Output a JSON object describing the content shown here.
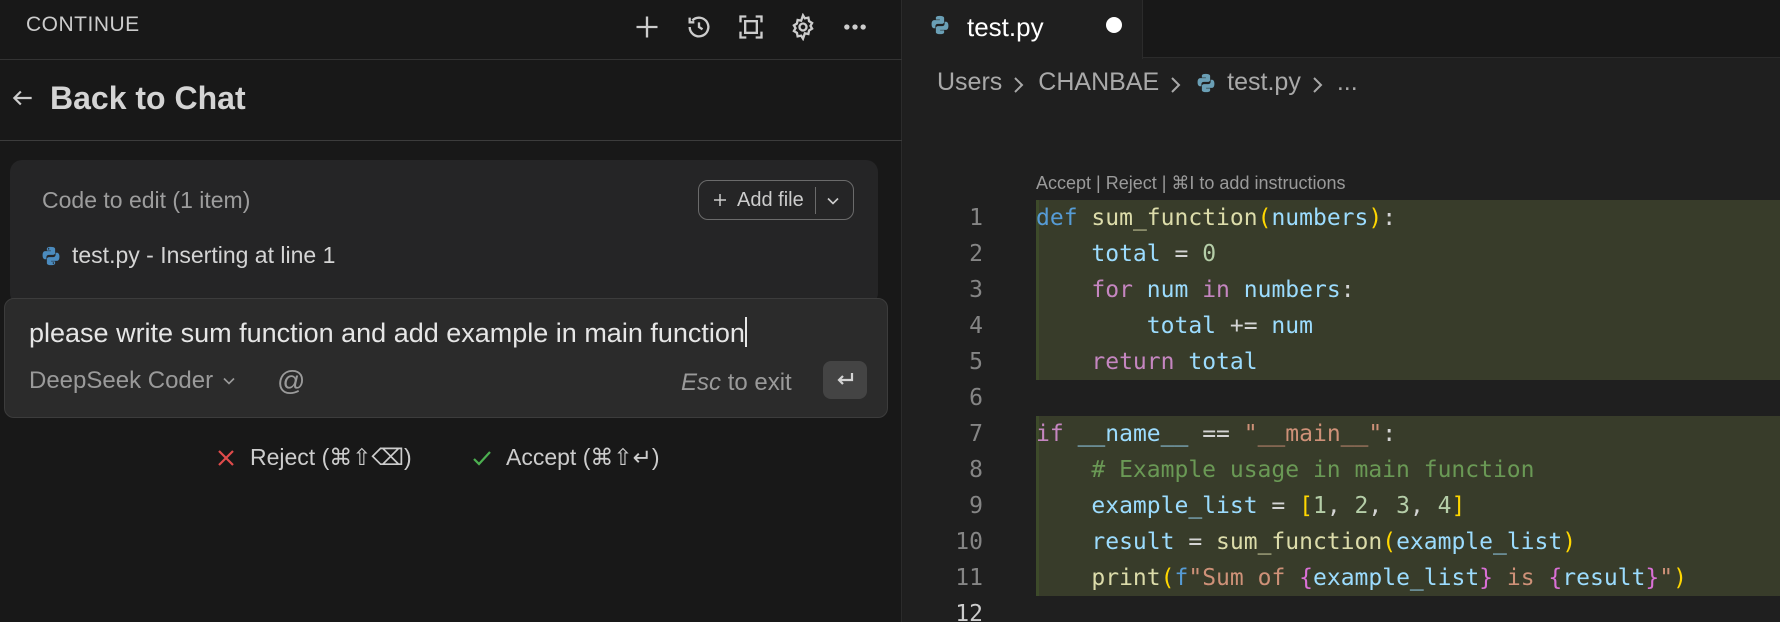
{
  "sidebar": {
    "app_title": "CONTINUE",
    "toolbar_icons": [
      "plus-icon",
      "history-icon",
      "fullscreen-icon",
      "gear-icon",
      "more-icon"
    ],
    "back_label": "Back to Chat",
    "code_to_edit": {
      "title": "Code to edit (1 item)",
      "add_file_label": "Add file",
      "file_label": "test.py - Inserting at line 1"
    },
    "input": {
      "prompt": "please write sum function and add example in main function",
      "model": "DeepSeek Coder",
      "esc_key": "Esc",
      "esc_suffix": "to exit"
    },
    "actions": {
      "reject_label": "Reject (⌘⇧⌫)",
      "accept_label": "Accept (⌘⇧↵)",
      "reject_color": "#e04b4b",
      "accept_color": "#4caf50"
    }
  },
  "editor": {
    "tab_name": "test.py",
    "tab_modified": true,
    "breadcrumb": [
      "Users",
      "CHANBAE",
      "test.py",
      "..."
    ],
    "codelens": "Accept | Reject | ⌘I to add instructions",
    "highlight_color": "#383c2a",
    "lines": [
      {
        "n": "1",
        "code": "def sum_function(numbers):"
      },
      {
        "n": "2",
        "code": "    total = 0"
      },
      {
        "n": "3",
        "code": "    for num in numbers:"
      },
      {
        "n": "4",
        "code": "        total += num"
      },
      {
        "n": "5",
        "code": "    return total"
      },
      {
        "n": "6",
        "code": ""
      },
      {
        "n": "7",
        "code": "if __name__ == \"__main__\":"
      },
      {
        "n": "8",
        "code": "    # Example usage in main function"
      },
      {
        "n": "9",
        "code": "    example_list = [1, 2, 3, 4]"
      },
      {
        "n": "10",
        "code": "    result = sum_function(example_list)"
      },
      {
        "n": "11",
        "code": "    print(f\"Sum of {example_list} is {result}\")"
      },
      {
        "n": "12",
        "code": ""
      }
    ]
  }
}
